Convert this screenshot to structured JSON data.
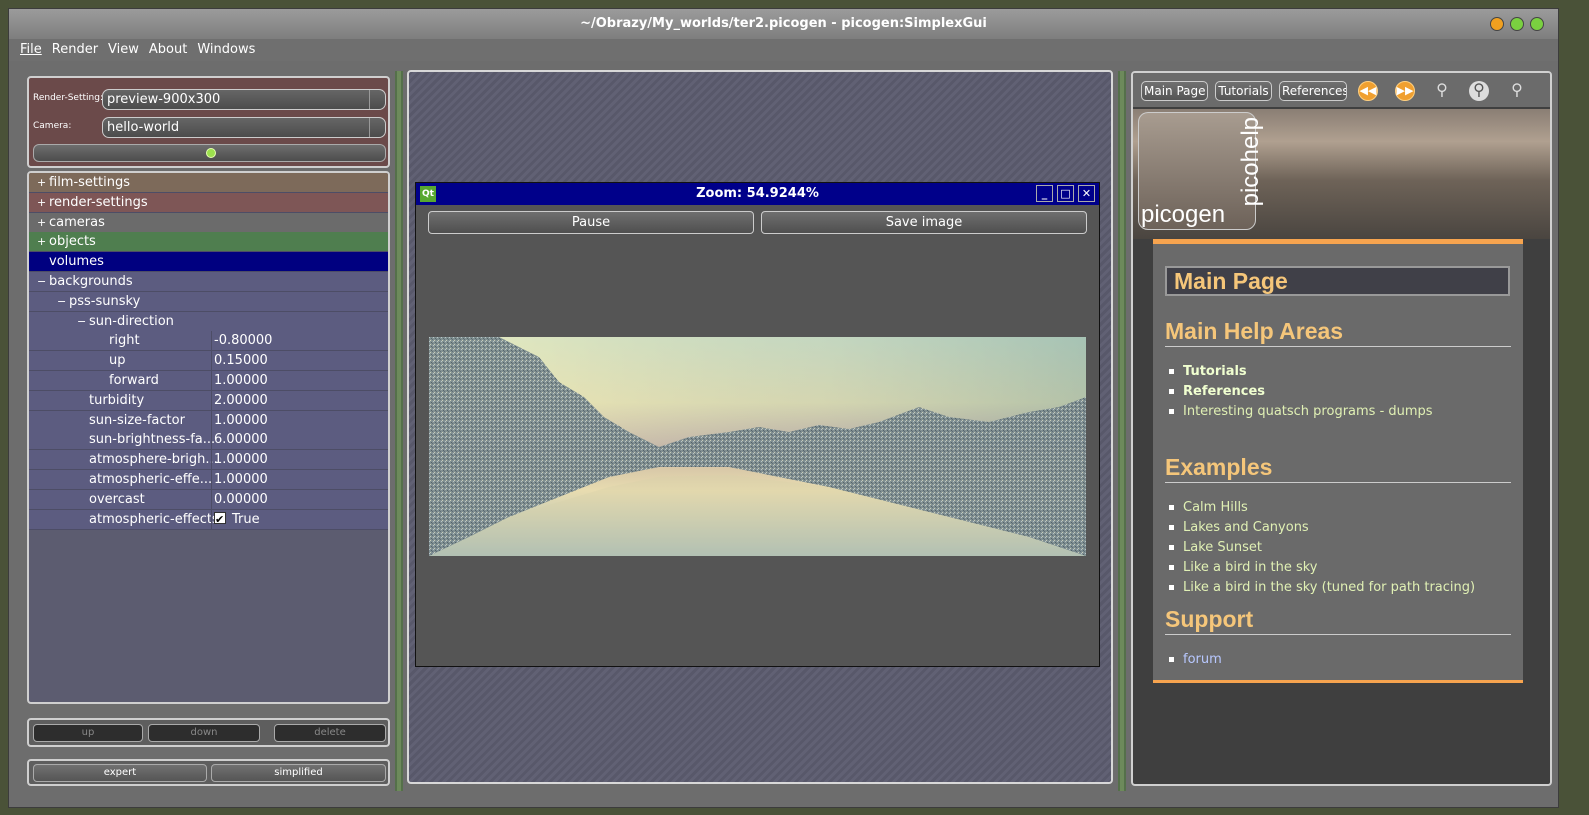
{
  "window": {
    "title": "~/Obrazy/My_worlds/ter2.picogen - picogen:SimplexGui",
    "controls": [
      "close-button-orange",
      "minimize-button-green",
      "maximize-button-green"
    ]
  },
  "menu": [
    "File",
    "Render",
    "View",
    "About",
    "Windows"
  ],
  "render_panel": {
    "render_setting_label": "Render-Setting:",
    "render_setting_value": "preview-900x300",
    "camera_label": "Camera:",
    "camera_value": "hello-world"
  },
  "tree": {
    "rows": [
      {
        "text": "film-settings",
        "exp": "+",
        "value": ""
      },
      {
        "text": "render-settings",
        "exp": "+",
        "value": ""
      },
      {
        "text": "cameras",
        "exp": "+",
        "value": ""
      },
      {
        "text": "objects",
        "exp": "+",
        "value": ""
      },
      {
        "text": "volumes",
        "exp": "",
        "value": ""
      },
      {
        "text": "backgrounds",
        "exp": "−",
        "value": ""
      },
      {
        "text": "pss-sunsky",
        "exp": "−",
        "value": ""
      },
      {
        "text": "sun-direction",
        "exp": "−",
        "value": ""
      },
      {
        "text": "right",
        "exp": "",
        "value": "-0.80000"
      },
      {
        "text": "up",
        "exp": "",
        "value": "0.15000"
      },
      {
        "text": "forward",
        "exp": "",
        "value": "1.00000"
      },
      {
        "text": "turbidity",
        "exp": "",
        "value": "2.00000"
      },
      {
        "text": "sun-size-factor",
        "exp": "",
        "value": "1.00000"
      },
      {
        "text": "sun-brightness-fa...",
        "exp": "",
        "value": "6.00000"
      },
      {
        "text": "atmosphere-brigh...",
        "exp": "",
        "value": "1.00000"
      },
      {
        "text": "atmospheric-effe...",
        "exp": "",
        "value": "1.00000"
      },
      {
        "text": "overcast",
        "exp": "",
        "value": "0.00000"
      },
      {
        "text": "atmospheric-effects",
        "exp": "",
        "value": "True"
      }
    ]
  },
  "list_buttons": {
    "up": "up",
    "down": "down",
    "delete": "delete"
  },
  "mode_buttons": {
    "expert": "expert",
    "simplified": "simplified"
  },
  "zoom_window": {
    "title": "Zoom: 54.9244%",
    "pause": "Pause",
    "save": "Save image",
    "qt_logo": "Qt"
  },
  "help": {
    "toolbar": {
      "main_page": "Main Page",
      "tutorials": "Tutorials",
      "references": "References"
    },
    "banner": {
      "logo": "picogen",
      "vertical": "picohelp"
    },
    "page_title": "Main Page",
    "sections": [
      {
        "heading": "Main Help Areas",
        "items": [
          "Tutorials",
          "References",
          "Interesting quatsch programs - dumps"
        ]
      },
      {
        "heading": "Examples",
        "items": [
          "Calm Hills",
          "Lakes and Canyons",
          "Lake Sunset",
          "Like a bird in the sky",
          "Like a bird in the sky (tuned for path tracing)"
        ]
      },
      {
        "heading": "Support",
        "items": [
          "forum"
        ]
      }
    ]
  },
  "colors": {
    "title_blue": "#00008a",
    "accent_orange": "#f7a44f",
    "heading_gold": "#f5c67a"
  }
}
